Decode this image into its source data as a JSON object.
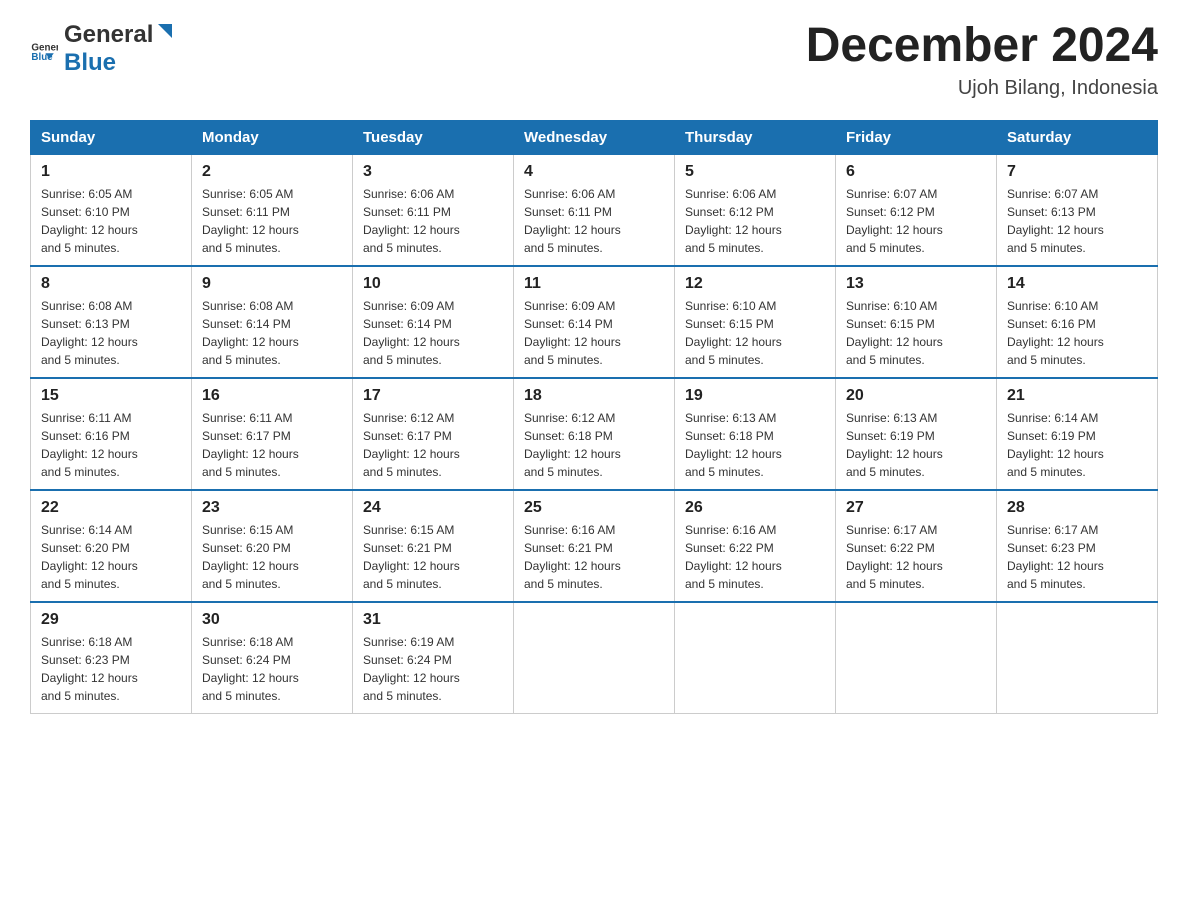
{
  "header": {
    "title": "December 2024",
    "location": "Ujoh Bilang, Indonesia",
    "logo_general": "General",
    "logo_blue": "Blue"
  },
  "days_of_week": [
    "Sunday",
    "Monday",
    "Tuesday",
    "Wednesday",
    "Thursday",
    "Friday",
    "Saturday"
  ],
  "weeks": [
    [
      {
        "day": "1",
        "sunrise": "6:05 AM",
        "sunset": "6:10 PM",
        "daylight": "12 hours and 5 minutes."
      },
      {
        "day": "2",
        "sunrise": "6:05 AM",
        "sunset": "6:11 PM",
        "daylight": "12 hours and 5 minutes."
      },
      {
        "day": "3",
        "sunrise": "6:06 AM",
        "sunset": "6:11 PM",
        "daylight": "12 hours and 5 minutes."
      },
      {
        "day": "4",
        "sunrise": "6:06 AM",
        "sunset": "6:11 PM",
        "daylight": "12 hours and 5 minutes."
      },
      {
        "day": "5",
        "sunrise": "6:06 AM",
        "sunset": "6:12 PM",
        "daylight": "12 hours and 5 minutes."
      },
      {
        "day": "6",
        "sunrise": "6:07 AM",
        "sunset": "6:12 PM",
        "daylight": "12 hours and 5 minutes."
      },
      {
        "day": "7",
        "sunrise": "6:07 AM",
        "sunset": "6:13 PM",
        "daylight": "12 hours and 5 minutes."
      }
    ],
    [
      {
        "day": "8",
        "sunrise": "6:08 AM",
        "sunset": "6:13 PM",
        "daylight": "12 hours and 5 minutes."
      },
      {
        "day": "9",
        "sunrise": "6:08 AM",
        "sunset": "6:14 PM",
        "daylight": "12 hours and 5 minutes."
      },
      {
        "day": "10",
        "sunrise": "6:09 AM",
        "sunset": "6:14 PM",
        "daylight": "12 hours and 5 minutes."
      },
      {
        "day": "11",
        "sunrise": "6:09 AM",
        "sunset": "6:14 PM",
        "daylight": "12 hours and 5 minutes."
      },
      {
        "day": "12",
        "sunrise": "6:10 AM",
        "sunset": "6:15 PM",
        "daylight": "12 hours and 5 minutes."
      },
      {
        "day": "13",
        "sunrise": "6:10 AM",
        "sunset": "6:15 PM",
        "daylight": "12 hours and 5 minutes."
      },
      {
        "day": "14",
        "sunrise": "6:10 AM",
        "sunset": "6:16 PM",
        "daylight": "12 hours and 5 minutes."
      }
    ],
    [
      {
        "day": "15",
        "sunrise": "6:11 AM",
        "sunset": "6:16 PM",
        "daylight": "12 hours and 5 minutes."
      },
      {
        "day": "16",
        "sunrise": "6:11 AM",
        "sunset": "6:17 PM",
        "daylight": "12 hours and 5 minutes."
      },
      {
        "day": "17",
        "sunrise": "6:12 AM",
        "sunset": "6:17 PM",
        "daylight": "12 hours and 5 minutes."
      },
      {
        "day": "18",
        "sunrise": "6:12 AM",
        "sunset": "6:18 PM",
        "daylight": "12 hours and 5 minutes."
      },
      {
        "day": "19",
        "sunrise": "6:13 AM",
        "sunset": "6:18 PM",
        "daylight": "12 hours and 5 minutes."
      },
      {
        "day": "20",
        "sunrise": "6:13 AM",
        "sunset": "6:19 PM",
        "daylight": "12 hours and 5 minutes."
      },
      {
        "day": "21",
        "sunrise": "6:14 AM",
        "sunset": "6:19 PM",
        "daylight": "12 hours and 5 minutes."
      }
    ],
    [
      {
        "day": "22",
        "sunrise": "6:14 AM",
        "sunset": "6:20 PM",
        "daylight": "12 hours and 5 minutes."
      },
      {
        "day": "23",
        "sunrise": "6:15 AM",
        "sunset": "6:20 PM",
        "daylight": "12 hours and 5 minutes."
      },
      {
        "day": "24",
        "sunrise": "6:15 AM",
        "sunset": "6:21 PM",
        "daylight": "12 hours and 5 minutes."
      },
      {
        "day": "25",
        "sunrise": "6:16 AM",
        "sunset": "6:21 PM",
        "daylight": "12 hours and 5 minutes."
      },
      {
        "day": "26",
        "sunrise": "6:16 AM",
        "sunset": "6:22 PM",
        "daylight": "12 hours and 5 minutes."
      },
      {
        "day": "27",
        "sunrise": "6:17 AM",
        "sunset": "6:22 PM",
        "daylight": "12 hours and 5 minutes."
      },
      {
        "day": "28",
        "sunrise": "6:17 AM",
        "sunset": "6:23 PM",
        "daylight": "12 hours and 5 minutes."
      }
    ],
    [
      {
        "day": "29",
        "sunrise": "6:18 AM",
        "sunset": "6:23 PM",
        "daylight": "12 hours and 5 minutes."
      },
      {
        "day": "30",
        "sunrise": "6:18 AM",
        "sunset": "6:24 PM",
        "daylight": "12 hours and 5 minutes."
      },
      {
        "day": "31",
        "sunrise": "6:19 AM",
        "sunset": "6:24 PM",
        "daylight": "12 hours and 5 minutes."
      },
      null,
      null,
      null,
      null
    ]
  ],
  "labels": {
    "sunrise": "Sunrise:",
    "sunset": "Sunset:",
    "daylight": "Daylight:"
  },
  "colors": {
    "header_bg": "#1a6faf",
    "accent_blue": "#1a6faf"
  }
}
